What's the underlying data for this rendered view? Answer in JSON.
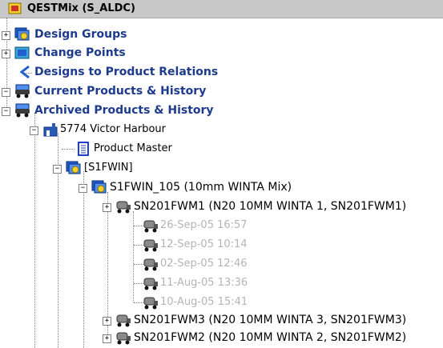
{
  "tree": {
    "root_label": "QESTMix (S_ALDC)",
    "nodes": [
      {
        "label": "Design Groups",
        "icon": "design-groups-icon",
        "state": "collapsed"
      },
      {
        "label": "Change Points",
        "icon": "change-points-icon",
        "state": "collapsed"
      },
      {
        "label": "Designs to Product Relations",
        "icon": "relations-icon",
        "state": "leaf"
      },
      {
        "label": "Current Products & History",
        "icon": "truck-icon",
        "state": "expanded"
      },
      {
        "label": "Archived Products & History",
        "icon": "truck-icon",
        "state": "expanded"
      },
      {
        "label": "5774 Victor Harbour",
        "icon": "plant-icon",
        "state": "expanded"
      },
      {
        "label": "Product Master",
        "icon": "document-icon",
        "state": "leaf"
      },
      {
        "label": "[S1FWIN]",
        "icon": "design-group-icon",
        "state": "expanded"
      },
      {
        "label": "S1FWIN_105 (10mm WINTA Mix)",
        "icon": "mix-design-icon",
        "state": "expanded"
      },
      {
        "label": "SN201FWM1 (N20 10MM WINTA 1, SN201FWM1)",
        "icon": "truck-icon",
        "state": "expanded"
      },
      {
        "label": "26-Sep-05 16:57",
        "icon": "truck-icon",
        "state": "leaf"
      },
      {
        "label": "12-Sep-05 10:14",
        "icon": "truck-icon",
        "state": "leaf"
      },
      {
        "label": "02-Sep-05 12:46",
        "icon": "truck-icon",
        "state": "leaf"
      },
      {
        "label": "11-Aug-05 13:36",
        "icon": "truck-icon",
        "state": "leaf"
      },
      {
        "label": "10-Aug-05 15:41",
        "icon": "truck-icon",
        "state": "leaf"
      },
      {
        "label": "SN201FWM3 (N20 10MM WINTA 3, SN201FWM3)",
        "icon": "truck-icon",
        "state": "collapsed"
      },
      {
        "label": "SN201FWM2 (N20 10MM WINTA 2, SN201FWM2)",
        "icon": "truck-icon",
        "state": "collapsed"
      }
    ]
  },
  "colors": {
    "header_bg": "#c8c8c8",
    "bold_label": "#1d3b8e",
    "history_label": "#b4b4b4",
    "icon_blue": "#1f5fd0",
    "icon_yellow": "#f2d22a",
    "truck_body": "#3a3a3a"
  }
}
